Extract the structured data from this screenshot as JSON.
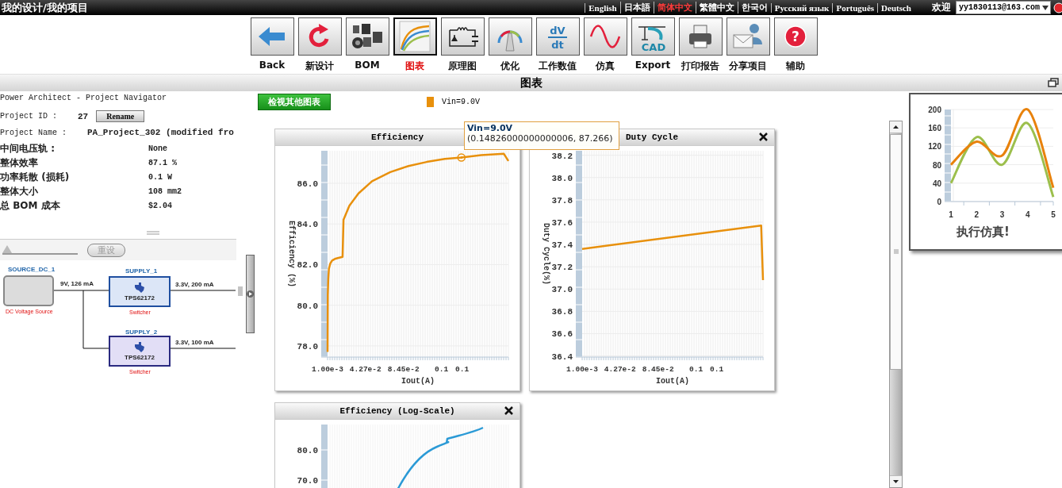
{
  "top_bar": {
    "breadcrumb": "我的设计/我的项目",
    "languages": [
      {
        "label": "English",
        "selected": false
      },
      {
        "label": "日本語",
        "selected": false
      },
      {
        "label": "简体中文",
        "selected": true
      },
      {
        "label": "繁體中文",
        "selected": false
      },
      {
        "label": "한국어",
        "selected": false
      },
      {
        "label": "Русский язык",
        "selected": false
      },
      {
        "label": "Português",
        "selected": false
      },
      {
        "label": "Deutsch",
        "selected": false
      }
    ],
    "welcome": "欢迎",
    "user": "yy1830113@163.com"
  },
  "toolbar": [
    {
      "label": "Back",
      "kind": "back",
      "selected": false
    },
    {
      "label": "新设计",
      "kind": "new",
      "selected": false
    },
    {
      "label": "BOM",
      "kind": "bom",
      "selected": false
    },
    {
      "label": "图表",
      "kind": "chart",
      "selected": true
    },
    {
      "label": "原理图",
      "kind": "schematic",
      "selected": false
    },
    {
      "label": "优化",
      "kind": "gauge",
      "selected": false
    },
    {
      "label": "工作数值",
      "kind": "dvdt",
      "selected": false,
      "icon_text": [
        "dV",
        "dt"
      ]
    },
    {
      "label": "仿真",
      "kind": "sine",
      "selected": false
    },
    {
      "label": "Export",
      "kind": "cad",
      "selected": false,
      "icon_text": [
        "CAD"
      ]
    },
    {
      "label": "打印报告",
      "kind": "print",
      "selected": false
    },
    {
      "label": "分享项目",
      "kind": "share",
      "selected": false
    },
    {
      "label": "辅助",
      "kind": "help",
      "selected": false,
      "icon_text": [
        "?"
      ]
    }
  ],
  "section_title": "图表",
  "navigator": {
    "title": "Power Architect - Project Navigator",
    "project_id_label": "Project ID :",
    "project_id": "27",
    "rename_button": "Rename",
    "project_name_label": "Project Name :",
    "project_name": "PA_Project_302 (modified fro",
    "properties": [
      {
        "label": "中间电压轨 :",
        "value": "None"
      },
      {
        "label": "整体效率",
        "value": "87.1 %"
      },
      {
        "label": "功率耗散 (损耗)",
        "value": "0.1 W"
      },
      {
        "label": "整体大小",
        "value": "108 mm2"
      },
      {
        "label": "总 BOM 成本",
        "value": "$2.04"
      }
    ],
    "slider": {
      "level": 0
    },
    "reset_button": {
      "label": "重设",
      "disabled": true
    }
  },
  "diagram": {
    "source": {
      "name": "SOURCE_DC_1",
      "type": "DC Voltage Source",
      "output": "9V, 126 mA"
    },
    "supplies": [
      {
        "name": "SUPPLY_1",
        "part": "TPS62172",
        "type": "Switcher",
        "output": "3.3V, 200 mA",
        "color": "#dce6f7"
      },
      {
        "name": "SUPPLY_2",
        "part": "TPS62172",
        "type": "Switcher",
        "output": "3.3V, 100 mA",
        "color": "#e2def6"
      }
    ]
  },
  "charts_button": "检视其他图表",
  "legend": [
    {
      "label": "Vin=9.0V",
      "color": "#e8900c"
    }
  ],
  "tooltip": {
    "title": "Vin=9.0V",
    "text": "(0.14826000000000006, 87.266)"
  },
  "charts": [
    {
      "title": "Efficiency",
      "kind": "line",
      "chart_data": {
        "type": "line",
        "grid": true,
        "xlabel": "Iout(A)",
        "ylabel": "Efficiency (%)",
        "xlim": [
          0.001,
          0.2
        ],
        "ylim": [
          77.45,
          87.6
        ],
        "xticks": [
          {
            "value": 0.001,
            "label": "1.00e-3"
          },
          {
            "value": 0.0427,
            "label": "4.27e-2"
          },
          {
            "value": 0.0845,
            "label": "8.45e-2"
          },
          {
            "value": 0.1263,
            "label": "0.1"
          },
          {
            "value": 0.149,
            "label": "0.1"
          }
        ],
        "yticks": [
          {
            "value": 78,
            "label": "78.0"
          },
          {
            "value": 80,
            "label": "80.0"
          },
          {
            "value": 82,
            "label": "82.0"
          },
          {
            "value": 84,
            "label": "84.0"
          },
          {
            "value": 86,
            "label": "86.0"
          }
        ],
        "x": [
          0.001,
          0.0013,
          0.0018,
          0.0025,
          0.004,
          0.006,
          0.009,
          0.013,
          0.0175,
          0.0185,
          0.025,
          0.035,
          0.05,
          0.07,
          0.09,
          0.11,
          0.13,
          0.14826,
          0.17,
          0.195,
          0.2
        ],
        "series": [
          {
            "color": "#e8900c",
            "values": [
              77.7,
              80.5,
              81.3,
              81.8,
              82.05,
              82.2,
              82.28,
              82.33,
              82.38,
              84.2,
              84.9,
              85.5,
              86.1,
              86.55,
              86.85,
              87.05,
              87.2,
              87.27,
              87.38,
              87.45,
              87.1
            ]
          },
          {
            "marker": true,
            "color": "#e8900c",
            "values": [
              null,
              null,
              null,
              null,
              null,
              null,
              null,
              null,
              null,
              null,
              null,
              null,
              null,
              null,
              null,
              null,
              null,
              87.27,
              null,
              null,
              null
            ]
          }
        ]
      }
    },
    {
      "title": "Duty Cycle",
      "closable": true,
      "kind": "line",
      "chart_data": {
        "type": "line",
        "grid": true,
        "xlabel": "Iout(A)",
        "ylabel": "Duty Cycle(%)",
        "xlim": [
          0.001,
          0.2
        ],
        "ylim": [
          36.39,
          38.24
        ],
        "xticks": [
          {
            "value": 0.001,
            "label": "1.00e-3"
          },
          {
            "value": 0.0427,
            "label": "4.27e-2"
          },
          {
            "value": 0.0845,
            "label": "8.45e-2"
          },
          {
            "value": 0.1263,
            "label": "0.1"
          },
          {
            "value": 0.149,
            "label": "0.1"
          }
        ],
        "yticks": [
          {
            "value": 36.4,
            "label": "36.4"
          },
          {
            "value": 36.6,
            "label": "36.6"
          },
          {
            "value": 36.8,
            "label": "36.8"
          },
          {
            "value": 37,
            "label": "37.0"
          },
          {
            "value": 37.2,
            "label": "37.2"
          },
          {
            "value": 37.4,
            "label": "37.4"
          },
          {
            "value": 37.6,
            "label": "37.6"
          },
          {
            "value": 37.8,
            "label": "37.8"
          },
          {
            "value": 38,
            "label": "38.0"
          },
          {
            "value": 38.2,
            "label": "38.2"
          }
        ],
        "x": [
          0.001,
          0.198,
          0.2
        ],
        "series": [
          {
            "color": "#e8900c",
            "values": [
              37.36,
              37.57,
              37.08
            ]
          }
        ]
      }
    },
    {
      "title": "Efficiency (Log-Scale)",
      "closable": true,
      "kind": "curve",
      "y_tick_labels": [
        "80.0",
        "70.0"
      ]
    }
  ],
  "preview": {
    "caption": "执行仿真!",
    "chart_data": {
      "type": "line",
      "grid": true,
      "categories": [
        "1",
        "2",
        "3",
        "4",
        "5"
      ],
      "ylim": [
        0,
        200
      ],
      "yticks": [
        0,
        40,
        80,
        120,
        160,
        200
      ],
      "series": [
        {
          "color": "#e8820c",
          "values": [
            80,
            130,
            100,
            200,
            30
          ]
        },
        {
          "color": "#9cbf4c",
          "values": [
            40,
            140,
            80,
            170,
            10
          ]
        }
      ]
    }
  }
}
